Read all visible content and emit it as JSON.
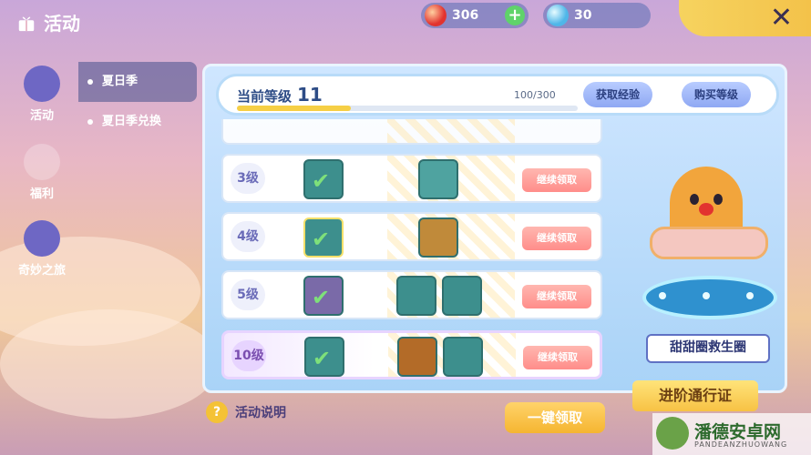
{
  "header": {
    "title": "活动",
    "currency_red": "306",
    "currency_blue": "30",
    "plus_label": "+",
    "close_label": "✕"
  },
  "leftnav": [
    {
      "label": "活动",
      "icon": "gift-icon",
      "active": true
    },
    {
      "label": "福利",
      "icon": "heart-icon",
      "active": false
    },
    {
      "label": "奇妙之旅",
      "icon": "ticket-star-icon",
      "active": false
    }
  ],
  "subnav": [
    {
      "label": "夏日季",
      "active": true
    },
    {
      "label": "夏日季兑换",
      "active": false
    }
  ],
  "level": {
    "label": "当前等级",
    "value": "11",
    "progress_text": "100/300",
    "progress": 0.3333,
    "get_exp": "获取经验",
    "buy_level": "购买等级"
  },
  "rows": [
    {
      "level": "3级",
      "claim": "继续领取"
    },
    {
      "level": "4级",
      "claim": "继续领取"
    },
    {
      "level": "5级",
      "claim": "继续领取"
    },
    {
      "level": "10级",
      "claim": "继续领取"
    }
  ],
  "showcase": {
    "name": "甜甜圈救生圈"
  },
  "footer": {
    "help": "活动说明",
    "claim_all": "一键领取",
    "pass": "进阶通行证"
  },
  "watermark": {
    "text": "潘德安卓网",
    "sub": "PANDEANZHUOWANG"
  }
}
